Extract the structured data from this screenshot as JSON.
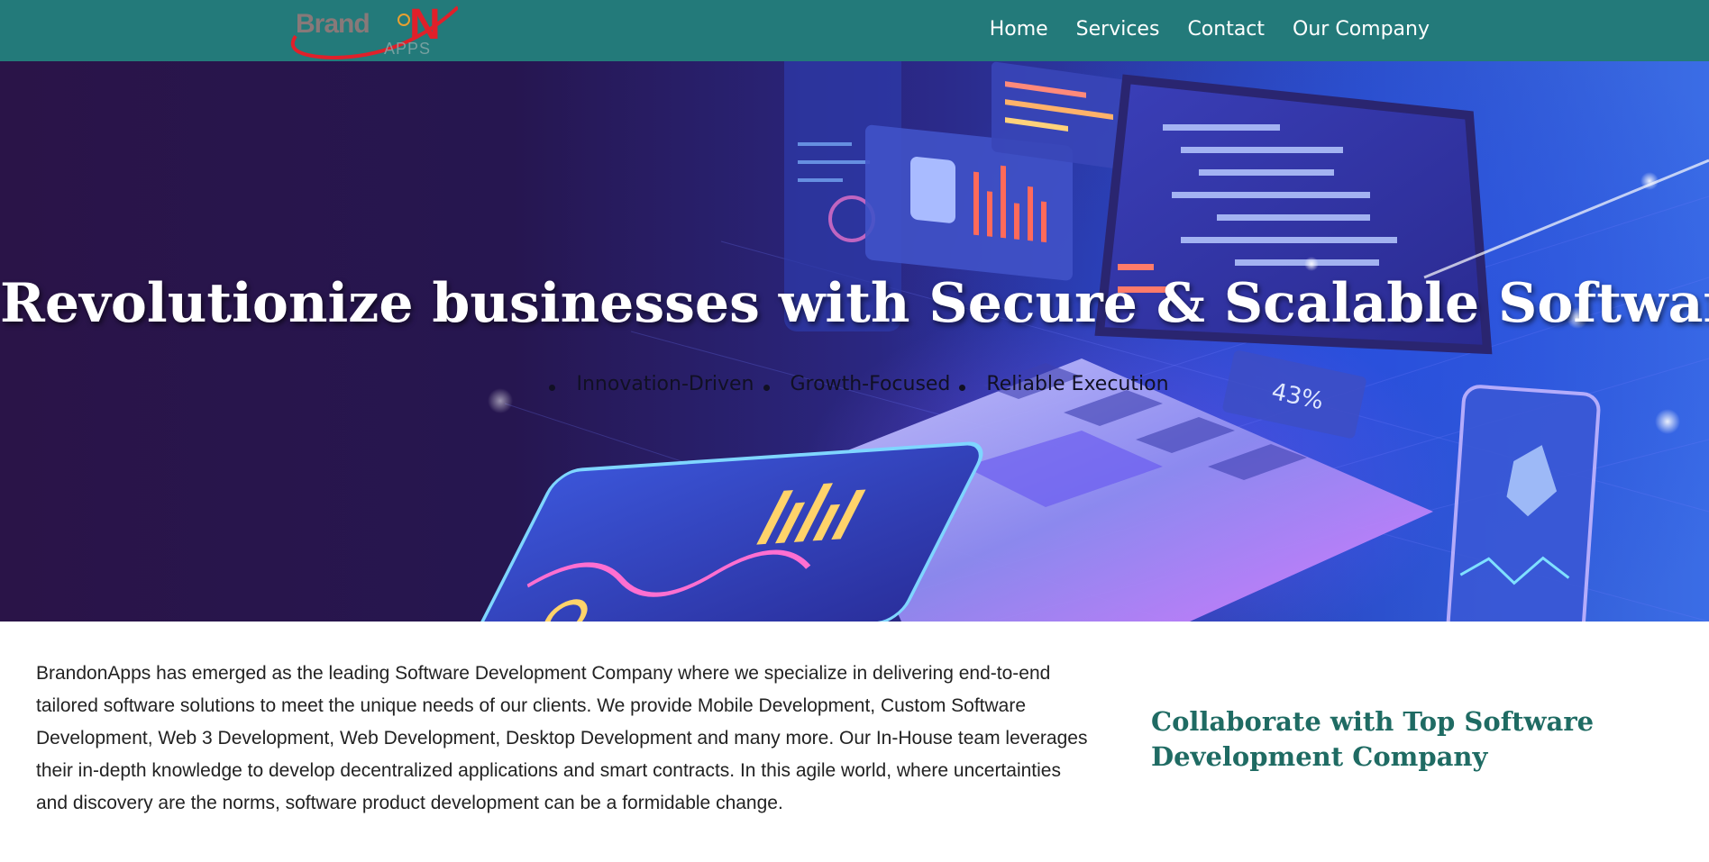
{
  "header": {
    "logo": {
      "brand": "Brand",
      "n": "N",
      "apps": "APPS"
    },
    "nav": [
      {
        "label": "Home"
      },
      {
        "label": "Services"
      },
      {
        "label": "Contact"
      },
      {
        "label": "Our Company"
      }
    ],
    "background_color": "#237a7a"
  },
  "hero": {
    "title": "Revolutionize businesses with Secure & Scalable Softwares",
    "bullets": [
      "Innovation-Driven",
      "Growth-Focused",
      "Reliable Execution"
    ],
    "screen_badge": "43%"
  },
  "about": {
    "paragraph": "BrandonApps has emerged as the leading Software Development Company where we specialize in delivering end-to-end tailored software solutions to meet the unique needs of our clients. We provide Mobile Development, Custom Software Development, Web 3 Development, Web Development, Desktop Development and many more. Our In-House team leverages their in-depth knowledge to develop decentralized applications and smart contracts. In this agile world, where uncertainties and discovery are the norms, software product development can be a formidable change."
  },
  "collaborate": {
    "title": "Collaborate with Top Software Development Company",
    "color": "#1f6b63"
  }
}
